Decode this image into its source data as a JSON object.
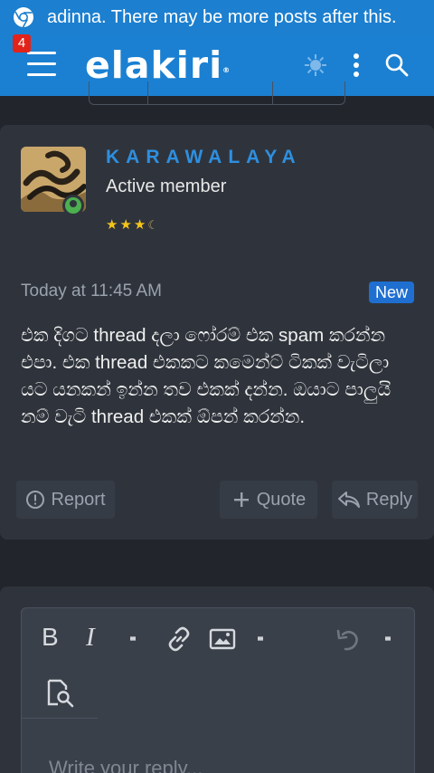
{
  "notification": {
    "text": "adinna. There may be more posts after this.",
    "icon": "chrome-icon"
  },
  "header": {
    "logo_text": "elakiri",
    "logo_mark": "®",
    "menu_badge_count": "4",
    "icons": [
      "menu-icon",
      "theme-toggle-icon",
      "more-vertical-icon",
      "search-icon"
    ],
    "background_color": "#1b80d1"
  },
  "post": {
    "username": "KARAWALAYA",
    "user_title": "Active member",
    "rating_stars": 3.5,
    "timestamp": "Today at 11:45 AM",
    "new_badge": "New",
    "message": "එක දිගට thread දලා ෆෝරම් එක spam කරන්න එපා. එක thread එකකට කමෙන්ට් ටිකක් වැටිලා යට යනකන් ඉන්න තව එකක් දන්න. ඔයාට පාලුයි නම් වැටි thread එකක් ඕපන් කරන්න.",
    "actions": {
      "report": "Report",
      "quote": "Quote",
      "reply": "Reply"
    }
  },
  "editor": {
    "toolbar": {
      "bold": "B",
      "italic": "I",
      "icons": [
        "more-options-icon",
        "link-icon",
        "image-icon",
        "more-options-icon",
        "undo-icon",
        "more-options-icon",
        "preview-icon"
      ]
    },
    "placeholder": "Write your reply..."
  },
  "colors": {
    "accent": "#1b80d1",
    "username": "#2e8fe0",
    "background": "#22262c",
    "card": "#2f343c",
    "new_badge": "#1f6fd1",
    "star": "#f5c518"
  }
}
